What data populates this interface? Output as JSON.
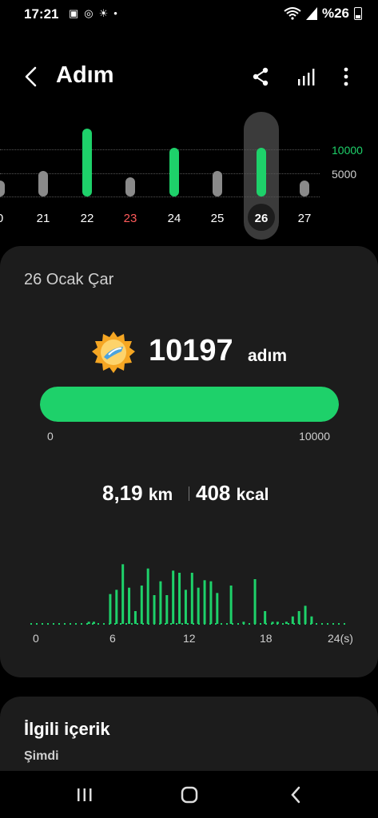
{
  "status": {
    "time": "17:21",
    "battery": "%26"
  },
  "header": {
    "title": "Adım"
  },
  "weekly": {
    "y_labels": [
      "10000",
      "5000"
    ],
    "days": [
      {
        "label": "0",
        "value": 3400,
        "color": "#8a8a8a",
        "label_color": "#ffffff"
      },
      {
        "label": "21",
        "value": 5300,
        "color": "#8a8a8a",
        "label_color": "#ffffff"
      },
      {
        "label": "22",
        "value": 15600,
        "color": "#1ed16a",
        "label_color": "#ffffff"
      },
      {
        "label": "23",
        "value": 4000,
        "color": "#8a8a8a",
        "label_color": "#ff5a5a"
      },
      {
        "label": "24",
        "value": 10200,
        "color": "#1ed16a",
        "label_color": "#ffffff"
      },
      {
        "label": "25",
        "value": 5300,
        "color": "#8a8a8a",
        "label_color": "#ffffff"
      },
      {
        "label": "26",
        "value": 10197,
        "color": "#1ed16a",
        "label_color": "#ffffff",
        "selected": true
      },
      {
        "label": "27",
        "value": 3400,
        "color": "#8a8a8a",
        "label_color": "#ffffff"
      }
    ]
  },
  "card": {
    "date": "26 Ocak Çar",
    "steps": "10197",
    "steps_unit": "adım",
    "progress_fraction": 1.0,
    "progress_min": "0",
    "progress_max": "10000",
    "distance": "8,19",
    "distance_unit": "km",
    "calories": "408",
    "calories_unit": "kcal",
    "hour_labels": [
      "0",
      "6",
      "12",
      "18",
      "24(s)"
    ],
    "hourly_bars": [
      {
        "h": 4.2,
        "v": 2
      },
      {
        "h": 4.6,
        "v": 2
      },
      {
        "h": 5.9,
        "v": 28
      },
      {
        "h": 6.4,
        "v": 32
      },
      {
        "h": 6.9,
        "v": 56
      },
      {
        "h": 7.4,
        "v": 34
      },
      {
        "h": 7.9,
        "v": 12
      },
      {
        "h": 8.4,
        "v": 36
      },
      {
        "h": 8.9,
        "v": 52
      },
      {
        "h": 9.4,
        "v": 27
      },
      {
        "h": 9.9,
        "v": 40
      },
      {
        "h": 10.4,
        "v": 27
      },
      {
        "h": 10.9,
        "v": 50
      },
      {
        "h": 11.4,
        "v": 48
      },
      {
        "h": 11.9,
        "v": 32
      },
      {
        "h": 12.4,
        "v": 48
      },
      {
        "h": 12.9,
        "v": 34
      },
      {
        "h": 13.4,
        "v": 41
      },
      {
        "h": 13.9,
        "v": 40
      },
      {
        "h": 14.4,
        "v": 29
      },
      {
        "h": 15.5,
        "v": 36
      },
      {
        "h": 16.5,
        "v": 2
      },
      {
        "h": 17.4,
        "v": 42
      },
      {
        "h": 18.2,
        "v": 12
      },
      {
        "h": 18.8,
        "v": 2
      },
      {
        "h": 19.2,
        "v": 2
      },
      {
        "h": 19.9,
        "v": 2
      },
      {
        "h": 20.4,
        "v": 7
      },
      {
        "h": 20.9,
        "v": 12
      },
      {
        "h": 21.4,
        "v": 17
      },
      {
        "h": 21.9,
        "v": 7
      }
    ]
  },
  "related": {
    "title": "İlgili içerik",
    "subtitle": "Şimdi"
  },
  "colors": {
    "accent": "#1ed16a",
    "card_bg": "#1c1c1c",
    "inactive_bar": "#8a8a8a"
  }
}
